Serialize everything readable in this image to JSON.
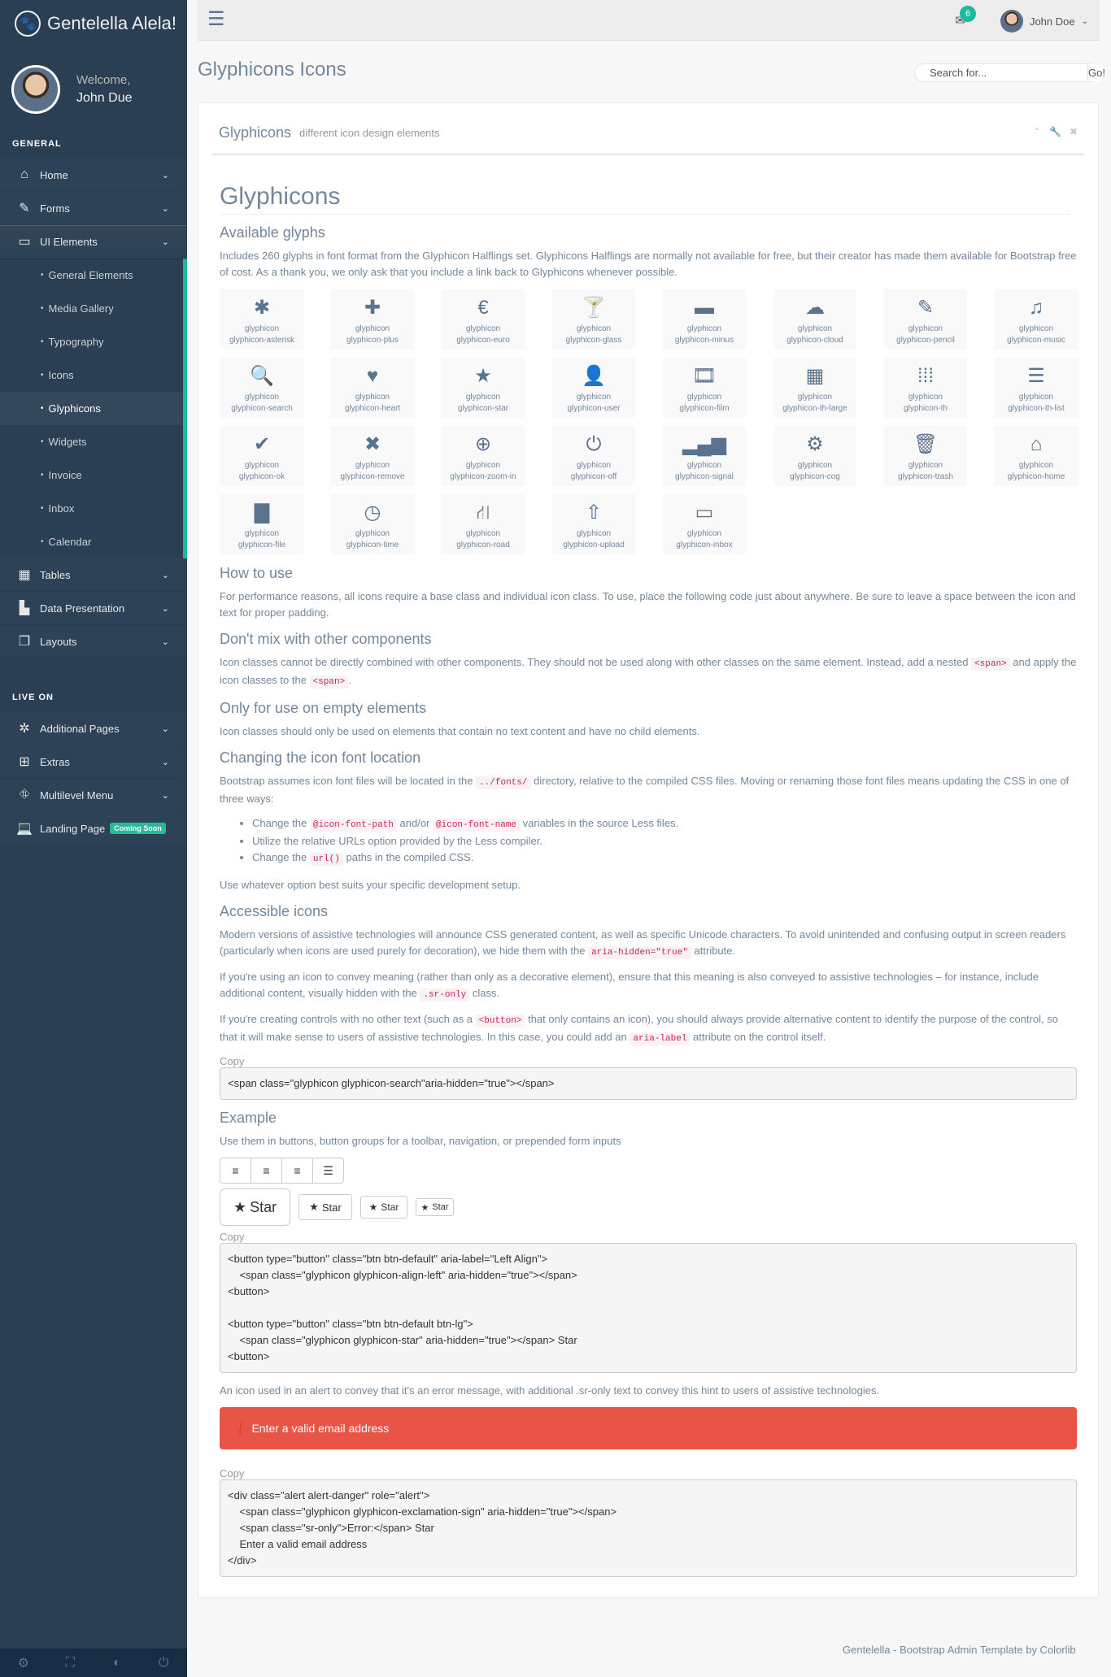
{
  "brand": {
    "title": "Gentelella Alela!",
    "logo_icon": "paw-icon"
  },
  "profile": {
    "welcome": "Welcome,",
    "name": "John Due"
  },
  "sections": {
    "general": "GENERAL",
    "live": "LIVE ON"
  },
  "menu": {
    "home": "Home",
    "forms": "Forms",
    "ui": "UI Elements",
    "ui_sub": [
      "General Elements",
      "Media Gallery",
      "Typography",
      "Icons",
      "Glyphicons",
      "Widgets",
      "Invoice",
      "Inbox",
      "Calendar"
    ],
    "tables": "Tables",
    "data": "Data Presentation",
    "layouts": "Layouts",
    "additional": "Additional Pages",
    "extras": "Extras",
    "multilevel": "Multilevel Menu",
    "landing": "Landing Page",
    "coming": "Coming Soon"
  },
  "topnav": {
    "mail_count": "6",
    "user": "John Doe"
  },
  "page": {
    "title": "Glyphicons Icons",
    "search_placeholder": "Search for...",
    "go": "Go!"
  },
  "panel": {
    "title": "Glyphicons",
    "subtitle": "different icon design elements"
  },
  "content": {
    "h1": "Glyphicons",
    "available_h": "Available glyphs",
    "available_p": "Includes 260 glyphs in font format from the Glyphicon Halflings set. Glyphicons Halflings are normally not available for free, but their creator has made them available for Bootstrap free of cost. As a thank you, we only ask that you include a link back to Glyphicons whenever possible.",
    "glyph_prefix": "glyphicon",
    "glyphs": [
      {
        "name": "glyphicon-asterisk",
        "g": "✱"
      },
      {
        "name": "glyphicon-plus",
        "g": "✚"
      },
      {
        "name": "glyphicon-euro",
        "g": "€"
      },
      {
        "name": "glyphicon-glass",
        "g": "🍸"
      },
      {
        "name": "glyphicon-minus",
        "g": "▬"
      },
      {
        "name": "glyphicon-cloud",
        "g": "☁"
      },
      {
        "name": "glyphicon-pencil",
        "g": "✎"
      },
      {
        "name": "glyphicon-music",
        "g": "♫"
      },
      {
        "name": "glyphicon-search",
        "g": "🔍"
      },
      {
        "name": "glyphicon-heart",
        "g": "♥"
      },
      {
        "name": "glyphicon-star",
        "g": "★"
      },
      {
        "name": "glyphicon-user",
        "g": "👤"
      },
      {
        "name": "glyphicon-film",
        "g": "🎞"
      },
      {
        "name": "glyphicon-th-large",
        "g": "▦"
      },
      {
        "name": "glyphicon-th",
        "g": "⁞⁞⁞"
      },
      {
        "name": "glyphicon-th-list",
        "g": "☰"
      },
      {
        "name": "glyphicon-ok",
        "g": "✔"
      },
      {
        "name": "glyphicon-remove",
        "g": "✖"
      },
      {
        "name": "glyphicon-zoom-in",
        "g": "⊕"
      },
      {
        "name": "glyphicon-off",
        "g": "⏻"
      },
      {
        "name": "glyphicon-signal",
        "g": "▂▄▆"
      },
      {
        "name": "glyphicon-cog",
        "g": "⚙"
      },
      {
        "name": "glyphicon-trash",
        "g": "🗑"
      },
      {
        "name": "glyphicon-home",
        "g": "⌂"
      },
      {
        "name": "glyphicon-file",
        "g": "▇"
      },
      {
        "name": "glyphicon-time",
        "g": "◷"
      },
      {
        "name": "glyphicon-road",
        "g": "⛙"
      },
      {
        "name": "glyphicon-upload",
        "g": "⇧"
      },
      {
        "name": "glyphicon-inbox",
        "g": "▭"
      }
    ],
    "howto_h": "How to use",
    "howto_p": "For performance reasons, all icons require a base class and individual icon class. To use, place the following code just about anywhere. Be sure to leave a space between the icon and text for proper padding.",
    "mix_h": "Don't mix with other components",
    "mix_p1": "Icon classes cannot be directly combined with other components. They should not be used along with other classes on the same element. Instead, add a nested",
    "mix_code1": "<span>",
    "mix_p2": "and apply the icon classes to the",
    "mix_code2": "<span>",
    "mix_p3": ".",
    "empty_h": "Only for use on empty elements",
    "empty_p": "Icon classes should only be used on elements that contain no text content and have no child elements.",
    "loc_h": "Changing the icon font location",
    "loc_p1": "Bootstrap assumes icon font files will be located in the",
    "loc_code": "../fonts/",
    "loc_p2": "directory, relative to the compiled CSS files. Moving or renaming those font files means updating the CSS in one of three ways:",
    "loc_li1a": "Change the",
    "loc_li1c1": "@icon-font-path",
    "loc_li1b": "and/or",
    "loc_li1c2": "@icon-font-name",
    "loc_li1d": "variables in the source Less files.",
    "loc_li2": "Utilize the relative URLs option provided by the Less compiler.",
    "loc_li3a": "Change the",
    "loc_li3c": "url()",
    "loc_li3b": "paths in the compiled CSS.",
    "loc_p3": "Use whatever option best suits your specific development setup.",
    "acc_h": "Accessible icons",
    "acc_p1a": "Modern versions of assistive technologies will announce CSS generated content, as well as specific Unicode characters. To avoid unintended and confusing output in screen readers (particularly when icons are used purely for decoration), we hide them with the",
    "acc_p1c": "aria-hidden=\"true\"",
    "acc_p1b": "attribute.",
    "acc_p2a": "If you're using an icon to convey meaning (rather than only as a decorative element), ensure that this meaning is also conveyed to assistive technologies – for instance, include additional content, visually hidden with the",
    "acc_p2c": ".sr-only",
    "acc_p2b": "class.",
    "acc_p3a": "If you're creating controls with no other text (such as a",
    "acc_p3c1": "<button>",
    "acc_p3b": "that only contains an icon), you should always provide alternative content to identify the purpose of the control, so that it will make sense to users of assistive technologies. In this case, you could add an",
    "acc_p3c2": "aria-label",
    "acc_p3d": "attribute on the control itself.",
    "copy": "Copy",
    "code1": "<span class=\"glyphicon glyphicon-search\"aria-hidden=\"true\"></span>",
    "example_h": "Example",
    "example_p": "Use them in buttons, button groups for a toolbar, navigation, or prepended form inputs",
    "star": "Star",
    "code2": "<button type=\"button\" class=\"btn btn-default\" aria-label=\"Left Align\">\n    <span class=\"glyphicon glyphicon-align-left\" aria-hidden=\"true\"></span>\n<button>\n\n<button type=\"button\" class=\"btn btn-default btn-lg\">\n    <span class=\"glyphicon glyphicon-star\" aria-hidden=\"true\"></span> Star\n<button>",
    "alert_p": "An icon used in an alert to convey that it's an error message, with additional .sr-only text to convey this hint to users of assistive technologies.",
    "alert_text": "Enter a valid email address",
    "code3": "<div class=\"alert alert-danger\" role=\"alert\">\n    <span class=\"glyphicon glyphicon-exclamation-sign\" aria-hidden=\"true\"></span>\n    <span class=\"sr-only\">Error:</span> Star\n    Enter a valid email address\n</div>"
  },
  "footer": "Gentelella - Bootstrap Admin Template by Colorlib"
}
